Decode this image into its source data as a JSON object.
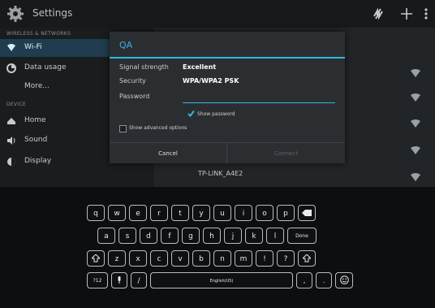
{
  "action_bar": {
    "title": "Settings",
    "icons": [
      "settings-gear-icon",
      "sync-icon",
      "add-icon",
      "overflow-menu-icon"
    ]
  },
  "sidebar": {
    "sections": [
      {
        "title": "WIRELESS & NETWORKS"
      },
      {
        "title": "DEVICE"
      }
    ],
    "items": [
      {
        "label": "Wi-Fi",
        "icon": "wifi-icon",
        "selected": true
      },
      {
        "label": "Data usage",
        "icon": "data-usage-icon"
      },
      {
        "label": "More..."
      },
      {
        "label": "Home",
        "icon": "home-icon"
      },
      {
        "label": "Sound",
        "icon": "speaker-icon"
      },
      {
        "label": "Display",
        "icon": "display-icon"
      }
    ]
  },
  "network_list": {
    "visible_network": "TP-LINK_A4E2"
  },
  "dialog": {
    "title": "QA",
    "signal_strength_label": "Signal strength",
    "signal_strength_value": "Excellent",
    "security_label": "Security",
    "security_value": "WPA/WPA2 PSK",
    "password_label": "Password",
    "password_value": "",
    "show_password_label": "Show password",
    "show_password_checked": true,
    "advanced_label": "Show advanced options",
    "advanced_checked": false,
    "cancel_label": "Cancel",
    "connect_label": "Connect"
  },
  "keyboard": {
    "rows": [
      [
        "q",
        "w",
        "e",
        "r",
        "t",
        "y",
        "u",
        "i",
        "o",
        "p",
        "backspace"
      ],
      [
        "a",
        "s",
        "d",
        "f",
        "g",
        "h",
        "j",
        "k",
        "l",
        "Done"
      ],
      [
        "shift",
        "z",
        "x",
        "c",
        "v",
        "b",
        "n",
        "m",
        "!",
        "?",
        "shift"
      ],
      [
        "?12",
        "mic",
        "/",
        "English(US)",
        ",",
        ".",
        "emoji"
      ]
    ]
  },
  "colors": {
    "accent": "#33b5e5",
    "background": "#101214",
    "dialog": "#2b2e31"
  }
}
